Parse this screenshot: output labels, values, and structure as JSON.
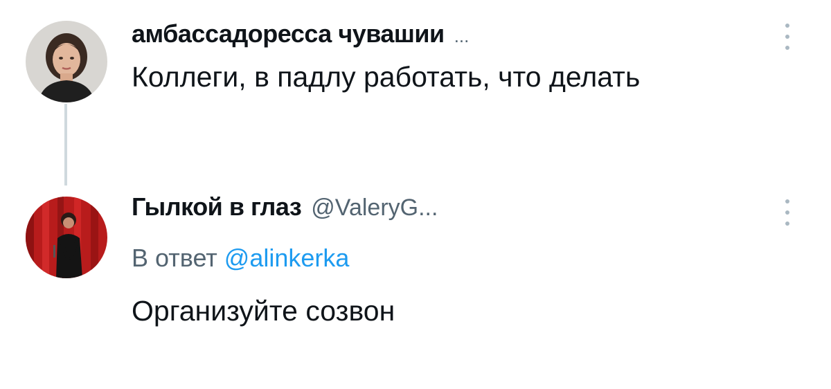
{
  "tweets": [
    {
      "display_name": "амбассадоресса чувашии",
      "name_overflow": "...",
      "text": "Коллеги, в падлу работать, что делать",
      "avatar_icon": "woman-portrait-avatar",
      "more_icon": "vertical-dots-icon"
    },
    {
      "display_name": "Гылкой в глаз",
      "handle": "@ValeryG...",
      "reply_prefix": "В ответ",
      "reply_to": "@alinkerka",
      "text": "Организуйте созвон",
      "avatar_icon": "stage-performer-avatar",
      "more_icon": "vertical-dots-icon"
    }
  ],
  "colors": {
    "text_primary": "#0f1419",
    "text_secondary": "#536471",
    "mention": "#1d9bf0",
    "thread_line": "#cfd9de"
  }
}
